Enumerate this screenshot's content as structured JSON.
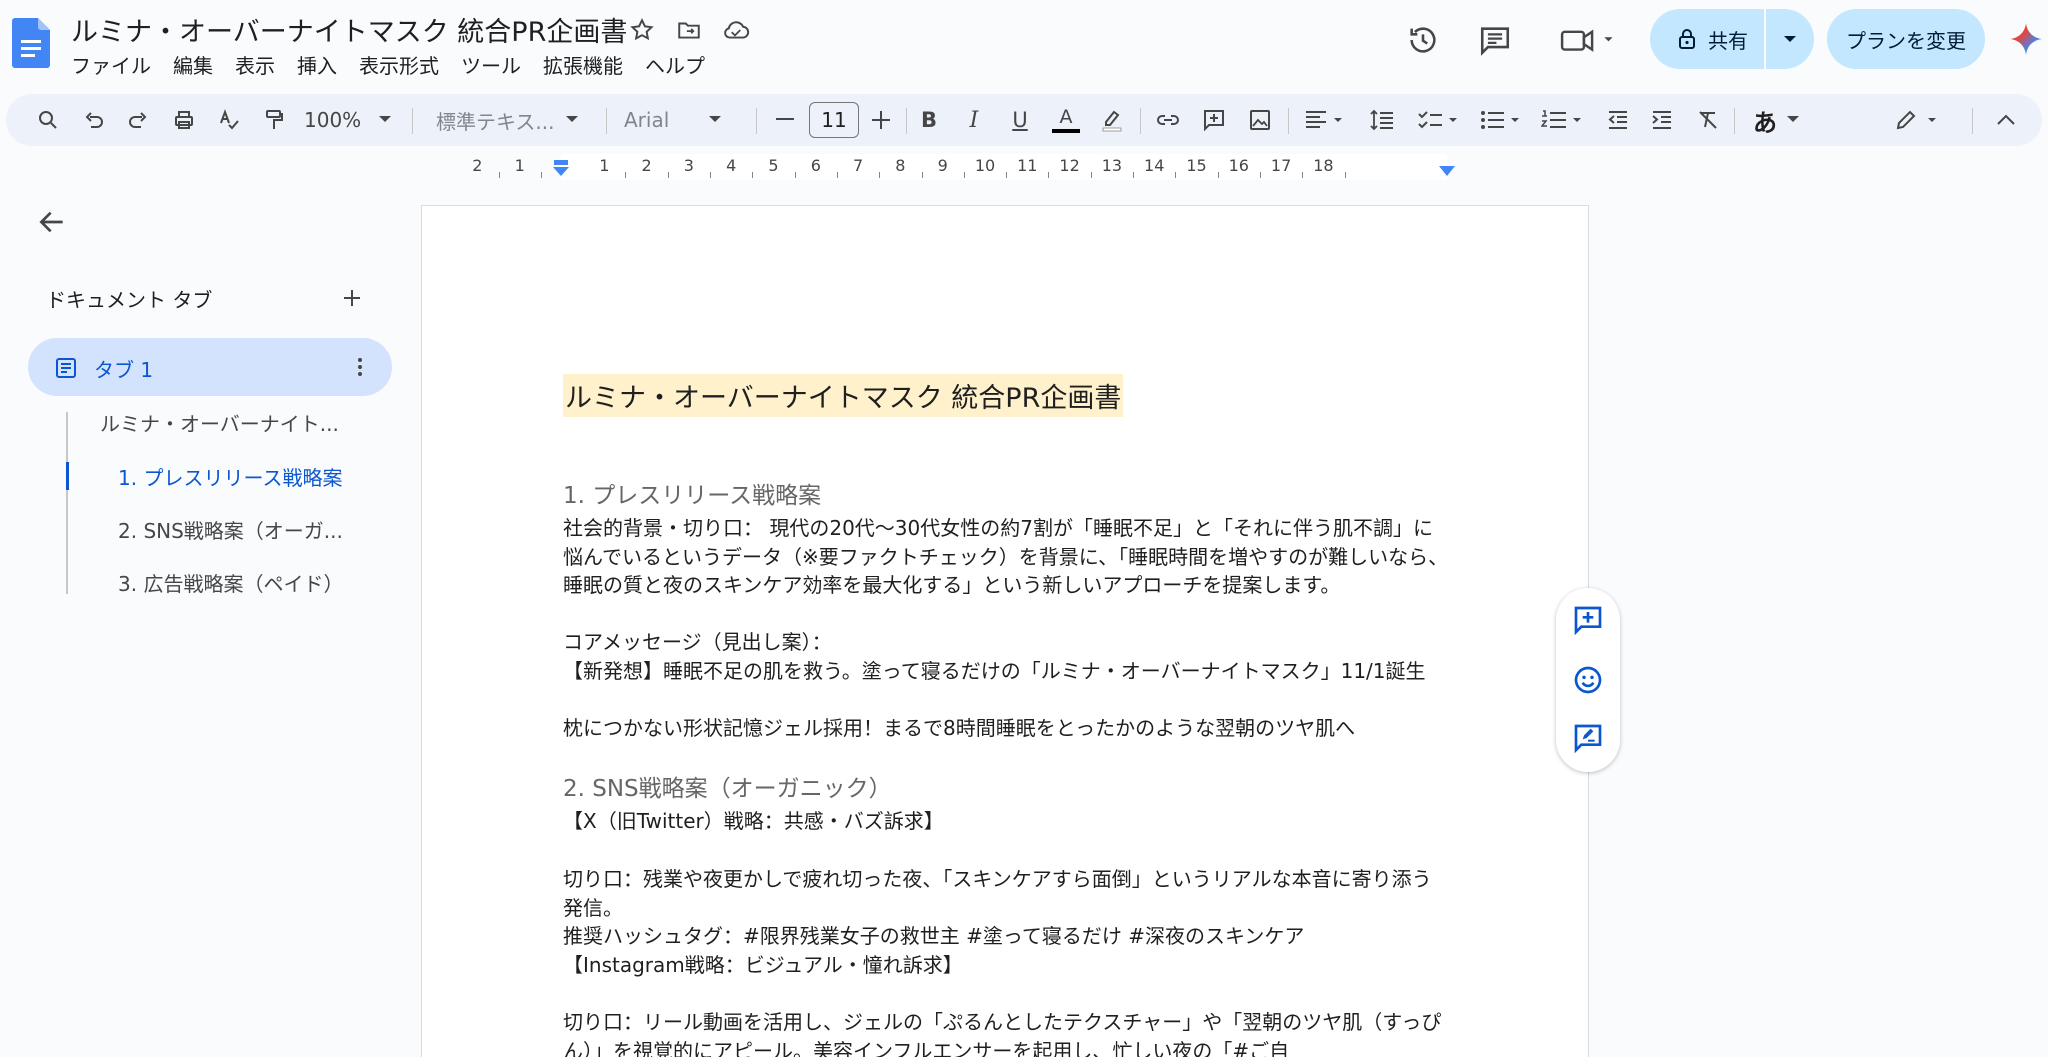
{
  "app": {
    "doc_title": "ルミナ・オーバーナイトマスク 統合PR企画書",
    "menu": [
      "ファイル",
      "編集",
      "表示",
      "挿入",
      "表示形式",
      "ツール",
      "拡張機能",
      "ヘルプ"
    ],
    "share_label": "共有",
    "plan_label": "プランを変更"
  },
  "toolbar": {
    "zoom": "100%",
    "style": "標準テキス...",
    "font": "Arial",
    "font_size": "11",
    "input_mode": "あ"
  },
  "ruler": {
    "numbers": [
      "2",
      "1",
      "1",
      "2",
      "3",
      "4",
      "5",
      "6",
      "7",
      "8",
      "9",
      "10",
      "11",
      "12",
      "13",
      "14",
      "15",
      "16",
      "17",
      "18"
    ]
  },
  "sidebar": {
    "heading": "ドキュメント タブ",
    "tab_label": "タブ 1",
    "outline": [
      "ルミナ・オーバーナイト...",
      "1. プレスリリース戦略案",
      "2. SNS戦略案（オーガ...",
      "3. 広告戦略案（ペイド）"
    ]
  },
  "document": {
    "title": "ルミナ・オーバーナイトマスク 統合PR企画書",
    "h_press": "1. プレスリリース戦略案",
    "p_background": "社会的背景・切り口： 現代の20代〜30代女性の約7割が「睡眠不足」と「それに伴う肌不調」に悩んでいるというデータ（※要ファクトチェック）を背景に、「睡眠時間を増やすのが難しいなら、睡眠の質と夜のスキンケア効率を最大化する」という新しいアプローチを提案します。",
    "p_core_label": "コアメッセージ（見出し案）：",
    "p_core_1": "【新発想】睡眠不足の肌を救う。塗って寝るだけの「ルミナ・オーバーナイトマスク」11/1誕生",
    "p_core_2": "枕につかない形状記憶ジェル採用！まるで8時間睡眠をとったかのような翌朝のツヤ肌へ",
    "h_sns": "2. SNS戦略案（オーガニック）",
    "p_x_head": "【X（旧Twitter）戦略：共感・バズ訴求】",
    "p_x_angle": "切り口：残業や夜更かしで疲れ切った夜、「スキンケアすら面倒」というリアルな本音に寄り添う発信。",
    "p_x_tags": "推奨ハッシュタグ：#限界残業女子の救世主 #塗って寝るだけ #深夜のスキンケア",
    "p_ig_head": "【Instagram戦略：ビジュアル・憧れ訴求】",
    "p_ig_angle": "切り口：リール動画を活用し、ジェルの「ぷるんとしたテクスチャー」や「翌朝のツヤ肌（すっぴん）」を視覚的にアピール。美容インフルエンサーを起用し、忙しい夜の「#ご自"
  },
  "colors": {
    "accent": "#0b57d0",
    "share_bg": "#c2e7ff",
    "title_highlight": "#fff1cc",
    "toolbar_bg": "#edf2fa"
  }
}
